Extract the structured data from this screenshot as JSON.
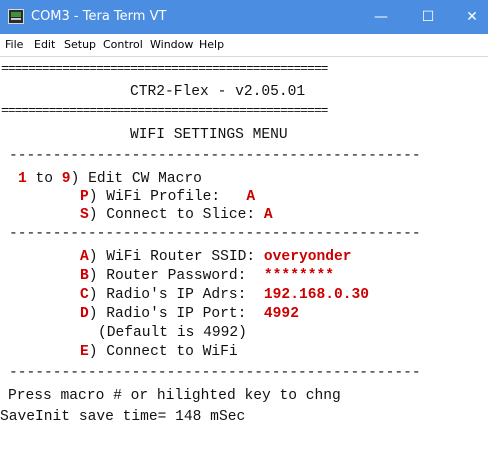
{
  "window": {
    "title": "COM3 - Tera Term VT",
    "icon": "teraterm-icon",
    "controls": {
      "minimize": "—",
      "maximize": "☐",
      "close": "✕"
    }
  },
  "menu": [
    "File",
    "Edit",
    "Setup",
    "Control",
    "Window",
    "Help"
  ],
  "colors": {
    "titlebar": "#4b8de0",
    "highlight": "#cc0000",
    "text": "#111111"
  },
  "terminal": {
    "sep_eq": "================================================",
    "sep_dash": "-----------------------------------------------",
    "banner": "CTR2-Flex - v2.05.01",
    "menu_title": "WIFI SETTINGS MENU",
    "macro": {
      "key_start": "1",
      "to": " to ",
      "key_end": "9",
      "label": ") Edit CW Macro"
    },
    "profile": {
      "key": "P",
      "label": ") WiFi Profile:   ",
      "value": "A"
    },
    "slice": {
      "key": "S",
      "label": ") Connect to Slice: ",
      "value": "A"
    },
    "ssid": {
      "key": "A",
      "label": ") WiFi Router SSID: ",
      "value": "overyonder"
    },
    "password": {
      "key": "B",
      "label": ") Router Password:  ",
      "value": "********"
    },
    "ip": {
      "key": "C",
      "label": ") Radio's IP Adrs:  ",
      "value": "192.168.0.30"
    },
    "port": {
      "key": "D",
      "label": ") Radio's IP Port:  ",
      "value": "4992"
    },
    "port_default": "(Default is 4992)",
    "connect": {
      "key": "E",
      "label": ") Connect to WiFi"
    },
    "prompt": "Press macro # or hilighted key to chng",
    "status": "SaveInit save time= 148 mSec"
  }
}
